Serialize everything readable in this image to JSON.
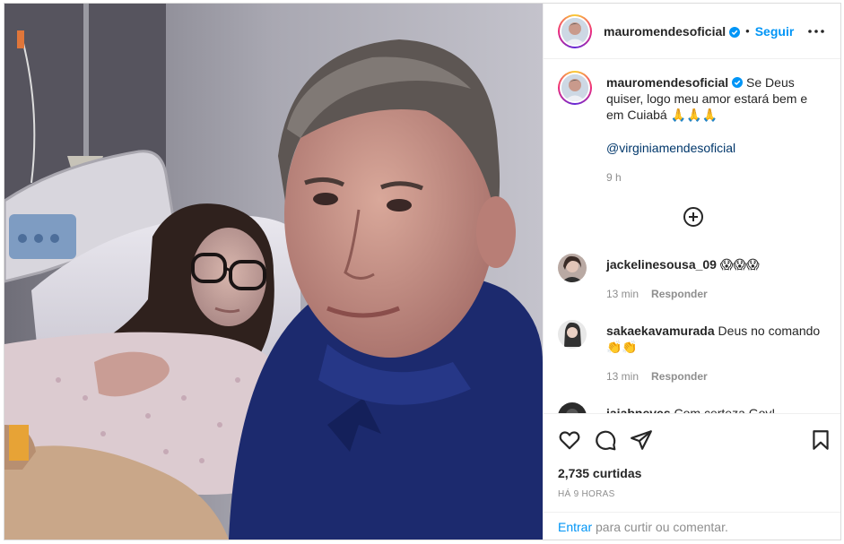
{
  "post": {
    "username": "mauromendesoficial",
    "follow_label": "Seguir",
    "dot": "•",
    "more_icon": "more-horizontal-icon"
  },
  "caption": {
    "username": "mauromendesoficial",
    "text": "Se Deus quiser, logo meu amor estará bem e em Cuiabá 🙏🙏🙏",
    "mention": "@virginiamendesoficial",
    "time": "9 h"
  },
  "comments": [
    {
      "username": "jackelinesousa_09",
      "text": "😱😱😱",
      "time": "13 min",
      "reply_label": "Responder"
    },
    {
      "username": "sakaekavamurada",
      "text": "Deus no comando 👏👏",
      "time": "13 min",
      "reply_label": "Responder"
    },
    {
      "username": "jaiabneves",
      "text": "Com certeza Gov!"
    }
  ],
  "actions": {
    "likes_text": "2,735 curtidas",
    "posted_ago": "HÁ 9 HORAS"
  },
  "add_comment": {
    "enter_label": "Entrar",
    "rest_text": " para curtir ou comentar."
  },
  "colors": {
    "accent": "#0095f6",
    "mention": "#00376b",
    "muted": "#8e8e8e"
  }
}
